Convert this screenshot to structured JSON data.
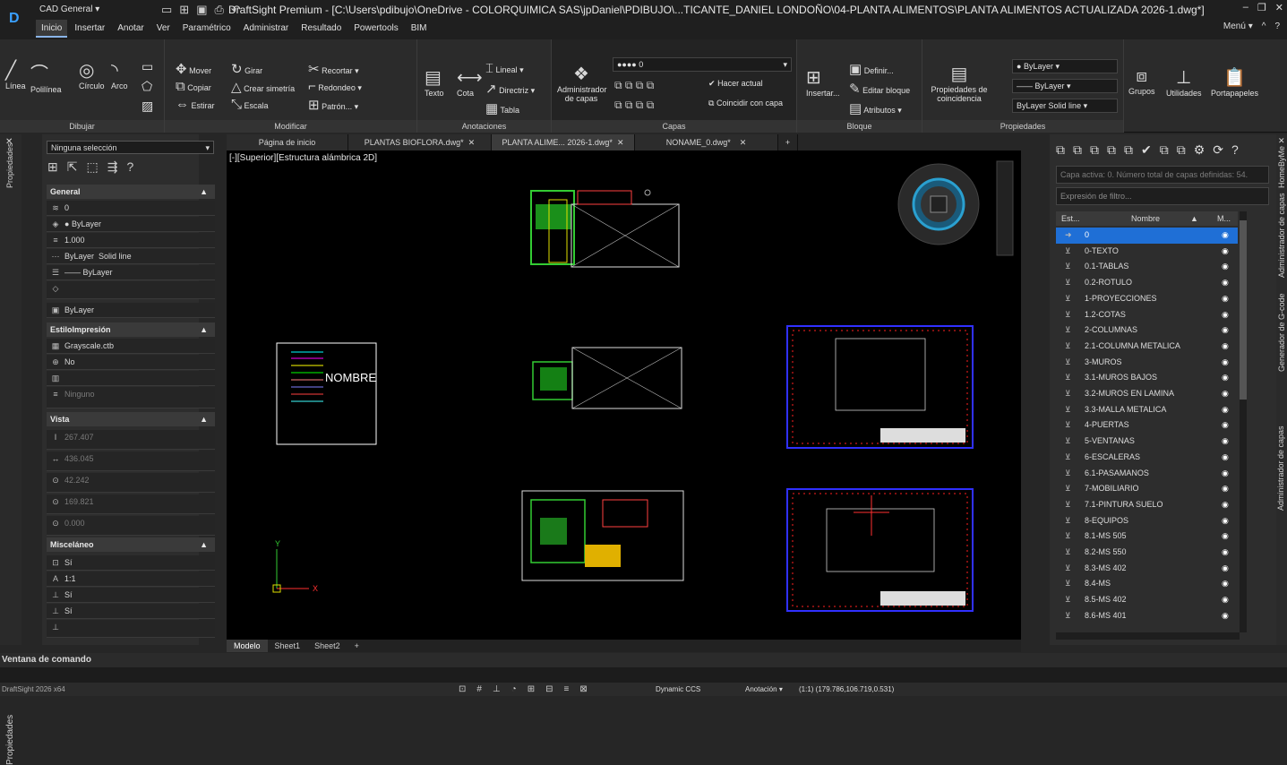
{
  "app": {
    "workspace": "CAD General",
    "title": "DraftSight Premium - [C:\\Users\\pdibujo\\OneDrive - COLORQUIMICA SAS\\jpDaniel\\PDIBUJO\\...TICANTE_DANIEL LONDOÑO\\04-PLANTA ALIMENTOS\\PLANTA ALIMENTOS ACTUALIZADA 2026-1.dwg*]",
    "version": "DraftSight 2026 x64"
  },
  "menu": {
    "tabs": [
      "Inicio",
      "Insertar",
      "Anotar",
      "Ver",
      "Paramétrico",
      "Administrar",
      "Resultado",
      "Powertools",
      "BIM"
    ],
    "right": "Menú"
  },
  "ribbon": {
    "dibujar": {
      "title": "Dibujar",
      "linea": "Línea",
      "polilinea": "Polilínea",
      "circulo": "Círculo",
      "arco": "Arco"
    },
    "modificar": {
      "title": "Modificar",
      "mover": "Mover",
      "copiar": "Copiar",
      "estirar": "Estirar",
      "girar": "Girar",
      "simetria": "Crear simetría",
      "escala": "Escala",
      "recortar": "Recortar",
      "redondeo": "Redondeo",
      "patron": "Patrón..."
    },
    "anotaciones": {
      "title": "Anotaciones",
      "texto": "Texto",
      "cota": "Cota",
      "lineal": "Lineal",
      "directriz": "Directriz",
      "tabla": "Tabla"
    },
    "capas": {
      "title": "Capas",
      "admin": "Administrador de capas",
      "layer_combo": "0",
      "hacer_actual": "Hacer actual",
      "coincidir": "Coincidir con capa"
    },
    "bloque": {
      "title": "Bloque",
      "insertar": "Insertar...",
      "definir": "Definir...",
      "editar": "Editar bloque",
      "atributos": "Atributos"
    },
    "propiedades": {
      "title": "Propiedades",
      "coincidencia": "Propiedades de coincidencia",
      "color": "ByLayer",
      "linetype": "ByLayer",
      "lineweight": "ByLayer",
      "solid": "Solid line"
    },
    "grupos": "Grupos",
    "utilidades": "Utilidades",
    "portapapeles": "Portapapeles"
  },
  "props": {
    "strip_label": "Propiedades",
    "strip_label2": "Propiedades",
    "selection": "Ninguna selección",
    "general": {
      "title": "General",
      "layer": "0",
      "color": "ByLayer",
      "scale": "1.000",
      "linetype": "ByLayer",
      "linetype2": "Solid line",
      "lineweight": "ByLayer",
      "transparency": "ByLayer"
    },
    "estilo": {
      "title": "EstiloImpresión",
      "table": "Grayscale.ctb",
      "val": "No",
      "none": "Ninguno"
    },
    "vista": {
      "title": "Vista",
      "v1": "267.407",
      "v2": "436.045",
      "v3": "42.242",
      "v4": "169.821",
      "v5": "0.000"
    },
    "misc": {
      "title": "Misceláneo",
      "m1": "Sí",
      "m2": "1:1",
      "m3": "Sí",
      "m4": "Sí"
    }
  },
  "docs": {
    "tabs": [
      "Página de inicio",
      "PLANTAS BIOFLORA.dwg*",
      "PLANTA ALIME... 2026-1.dwg*",
      "NONAME_0.dwg*"
    ],
    "view_label": "[-][Superior][Estructura alámbrica 2D]"
  },
  "canvas": {
    "nombre": "NOMBRE",
    "ucs_x": "X",
    "ucs_y": "Y"
  },
  "layouts": [
    "Modelo",
    "Sheet1",
    "Sheet2"
  ],
  "layers_panel": {
    "info": "Capa activa: 0. Número total de capas definidas: 54.",
    "filter": "Expresión de filtro...",
    "col_state": "Est...",
    "col_name": "Nombre",
    "col_m": "M...",
    "items": [
      "0",
      "0-TEXTO",
      "0.1-TABLAS",
      "0.2-ROTULO",
      "1-PROYECCIONES",
      "1.2-COTAS",
      "2-COLUMNAS",
      "2.1-COLUMNA METALICA",
      "3-MUROS",
      "3.1-MUROS BAJOS",
      "3.2-MUROS EN LAMINA",
      "3.3-MALLA METALICA",
      "4-PUERTAS",
      "5-VENTANAS",
      "6-ESCALERAS",
      "6.1-PASAMANOS",
      "7-MOBILIARIO",
      "7.1-PINTURA SUELO",
      "8-EQUIPOS",
      "8.1-MS 505",
      "8.2-MS 550",
      "8.3-MS 402",
      "8.4-MS",
      "8.5-MS 402",
      "8.6-MS 401"
    ]
  },
  "side_labels": {
    "homebyme": "HomeByMe",
    "admin_capas": "Administrador de capas",
    "gcode": "Generador de G-code",
    "admin_capas2": "Administrador de capas"
  },
  "command": {
    "title": "Ventana de comando"
  },
  "status": {
    "ccs": "Dynamic CCS",
    "anotacion": "Anotación",
    "coords": "(1:1) (179.786,106.719,0.531)"
  },
  "colors": {
    "accent": "#1f6fd6",
    "canvas": "#000000",
    "panel": "#2d2d2d"
  }
}
